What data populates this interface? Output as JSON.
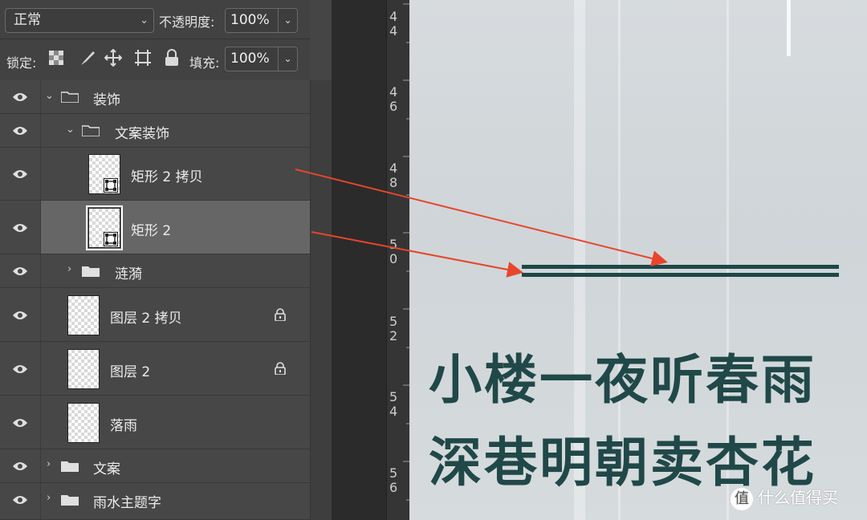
{
  "toolbar": {
    "blend_mode": "正常",
    "opacity_label": "不透明度:",
    "opacity_value": "100%",
    "lock_label": "锁定:",
    "fill_label": "填充:",
    "fill_value": "100%"
  },
  "layers": [
    {
      "name": "装饰",
      "type": "group",
      "expanded": true
    },
    {
      "name": "文案装饰",
      "type": "group",
      "expanded": true
    },
    {
      "name": "矩形 2 拷贝",
      "type": "shape"
    },
    {
      "name": "矩形 2",
      "type": "shape",
      "selected": true
    },
    {
      "name": "涟漪",
      "type": "group",
      "expanded": false
    },
    {
      "name": "图层 2 拷贝",
      "type": "layer",
      "locked": true
    },
    {
      "name": "图层 2",
      "type": "layer",
      "locked": true
    },
    {
      "name": "落雨",
      "type": "layer"
    },
    {
      "name": "文案",
      "type": "group",
      "expanded": false
    },
    {
      "name": "雨水主题字",
      "type": "group",
      "expanded": false
    }
  ],
  "ruler": [
    "4",
    "4",
    "4",
    "6",
    "4",
    "8",
    "5",
    "0",
    "5",
    "2",
    "5",
    "4",
    "5",
    "6"
  ],
  "canvas": {
    "line1": "小楼一夜听春雨",
    "line2": "深巷明朝卖杏花",
    "text_color": "#214848",
    "arrow_color": "#e8452c"
  },
  "watermark": {
    "icon": "值",
    "text": "什么值得买"
  }
}
